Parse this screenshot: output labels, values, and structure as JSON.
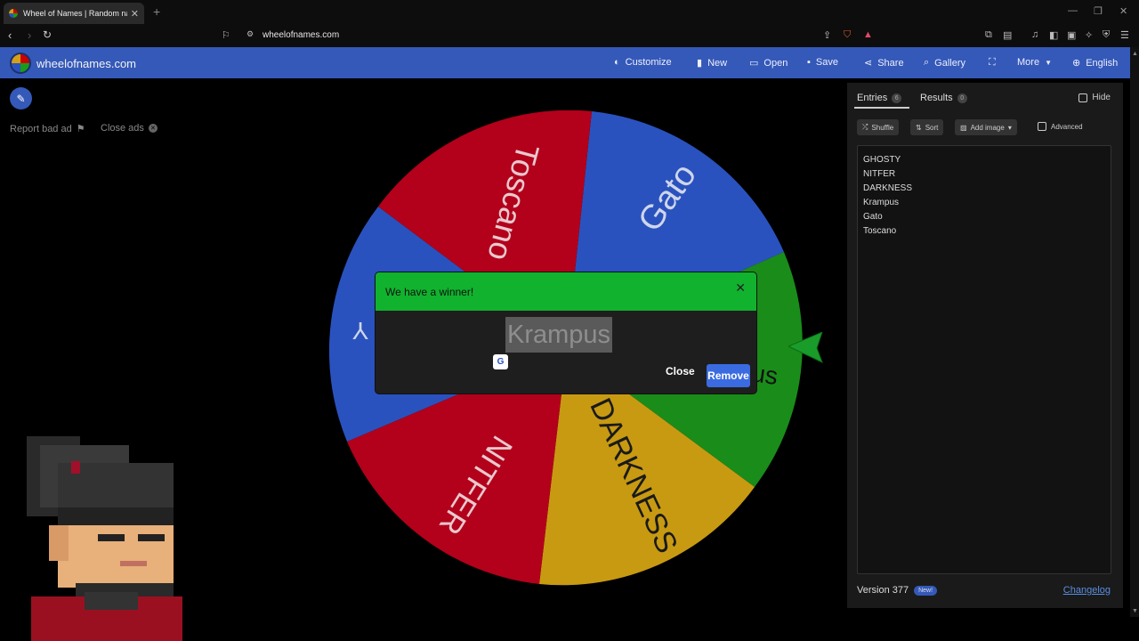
{
  "browser": {
    "tab_title": "Wheel of Names | Random name",
    "tab_close": "✕",
    "new_tab": "+",
    "url": "wheelofnames.com"
  },
  "header": {
    "brand": "wheelofnames.com",
    "menu": [
      {
        "label": "Customize",
        "icon": "palette-icon"
      },
      {
        "label": "New",
        "icon": "file-icon"
      },
      {
        "label": "Open",
        "icon": "folder-icon"
      },
      {
        "label": "Save",
        "icon": "save-icon"
      },
      {
        "label": "Share",
        "icon": "share-icon"
      },
      {
        "label": "Gallery",
        "icon": "search-icon"
      },
      {
        "label": "More",
        "icon": "chevron-down-icon"
      },
      {
        "label": "English",
        "icon": "globe-icon"
      }
    ]
  },
  "left": {
    "report_bad_ad": "Report bad ad",
    "close_ads": "Close ads"
  },
  "wheel": {
    "segments": [
      {
        "label": "Gato",
        "color": "#2a52be"
      },
      {
        "label": "Krampus",
        "color": "#1a8c1a"
      },
      {
        "label": "DARKNESS",
        "color": "#c89a12"
      },
      {
        "label": "NITFER",
        "color": "#b3001b"
      },
      {
        "label": "GHOSTY",
        "color": "#2a52be"
      },
      {
        "label": "Toscano",
        "color": "#b3001b"
      }
    ],
    "visible_text": {
      "gato": "Gato",
      "toscano": "Toscano",
      "darkness": "DARKNESS",
      "nitfer": "NITFER",
      "krampus_tail": "us",
      "ghosty_tail": "Y"
    }
  },
  "dialog": {
    "title": "We have a winner!",
    "winner": "Krampus",
    "close_label": "Close",
    "remove_label": "Remove",
    "header_color": "#11b22e"
  },
  "panel": {
    "tabs": [
      {
        "label": "Entries",
        "count": "6"
      },
      {
        "label": "Results",
        "count": "0"
      }
    ],
    "hide_label": "Hide",
    "tools": {
      "shuffle": "Shuffle",
      "sort": "Sort",
      "add_image": "Add image",
      "advanced": "Advanced"
    },
    "entries": [
      "GHOSTY",
      "NITFER",
      "DARKNESS",
      "Krampus",
      "Gato",
      "Toscano"
    ],
    "version": "Version 377",
    "new_badge": "New!",
    "changelog": "Changelog"
  }
}
